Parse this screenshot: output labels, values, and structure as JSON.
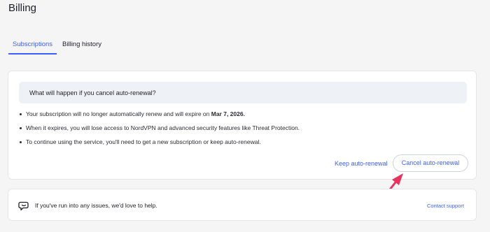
{
  "page": {
    "title": "Billing"
  },
  "tabs": [
    {
      "label": "Subscriptions",
      "active": true
    },
    {
      "label": "Billing history",
      "active": false
    }
  ],
  "cancel_card": {
    "question": "What will happen if you cancel auto-renewal?",
    "bullets": [
      {
        "text": "Your subscription will no longer automatically renew and will expire on ",
        "bold": "Mar 7, 2026."
      },
      {
        "text": "When it expires, you will lose access to NordVPN and advanced security features like Threat Protection.",
        "bold": ""
      },
      {
        "text": "To continue using the service, you'll need to get a new subscription or keep auto-renewal.",
        "bold": ""
      }
    ],
    "keep_label": "Keep auto-renewal",
    "cancel_label": "Cancel auto-renewal"
  },
  "help_card": {
    "icon": "chat-bubble-icon",
    "text": "If you've run into any issues, we'd love to help.",
    "link_label": "Contact support"
  },
  "colors": {
    "accent": "#3e5fff",
    "annotation_arrow": "#e8335e",
    "background": "#f5f5f6",
    "question_bg": "#eef2f7"
  }
}
